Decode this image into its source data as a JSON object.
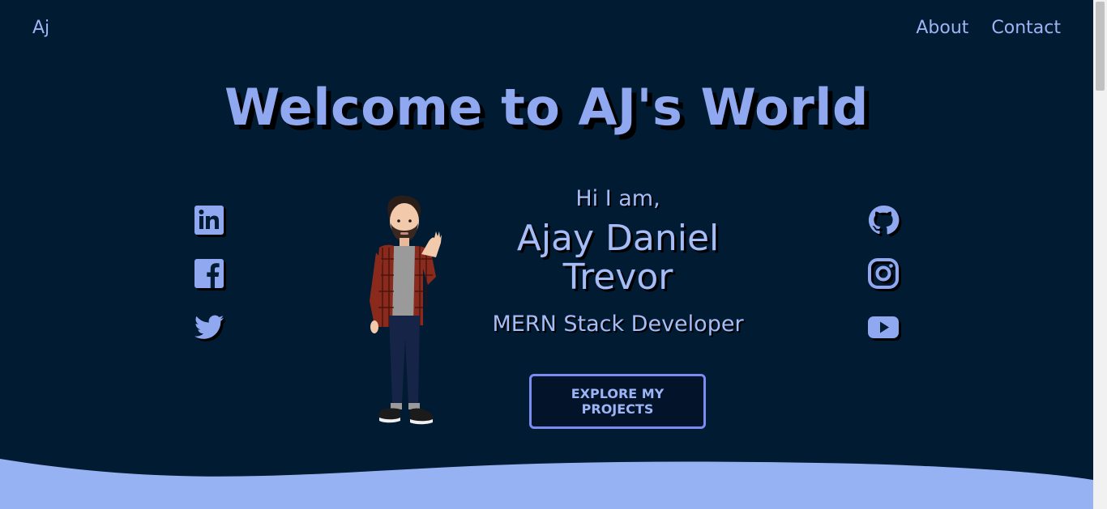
{
  "nav": {
    "brand": "Aj",
    "links": [
      "About",
      "Contact"
    ]
  },
  "hero": {
    "title": "Welcome to AJ's World",
    "greeting": "Hi I am,",
    "name_line1": "Ajay Daniel",
    "name_line2": "Trevor",
    "role": "MERN Stack Developer",
    "cta_label": "EXPLORE MY PROJECTS"
  },
  "social": {
    "left": [
      "linkedin-icon",
      "facebook-icon",
      "twitter-icon"
    ],
    "right": [
      "github-icon",
      "instagram-icon",
      "youtube-icon"
    ]
  },
  "colors": {
    "background": "#011b32",
    "accent": "#9db4f5",
    "wave": "#97b2f3",
    "button_border": "#7a8cf0"
  }
}
